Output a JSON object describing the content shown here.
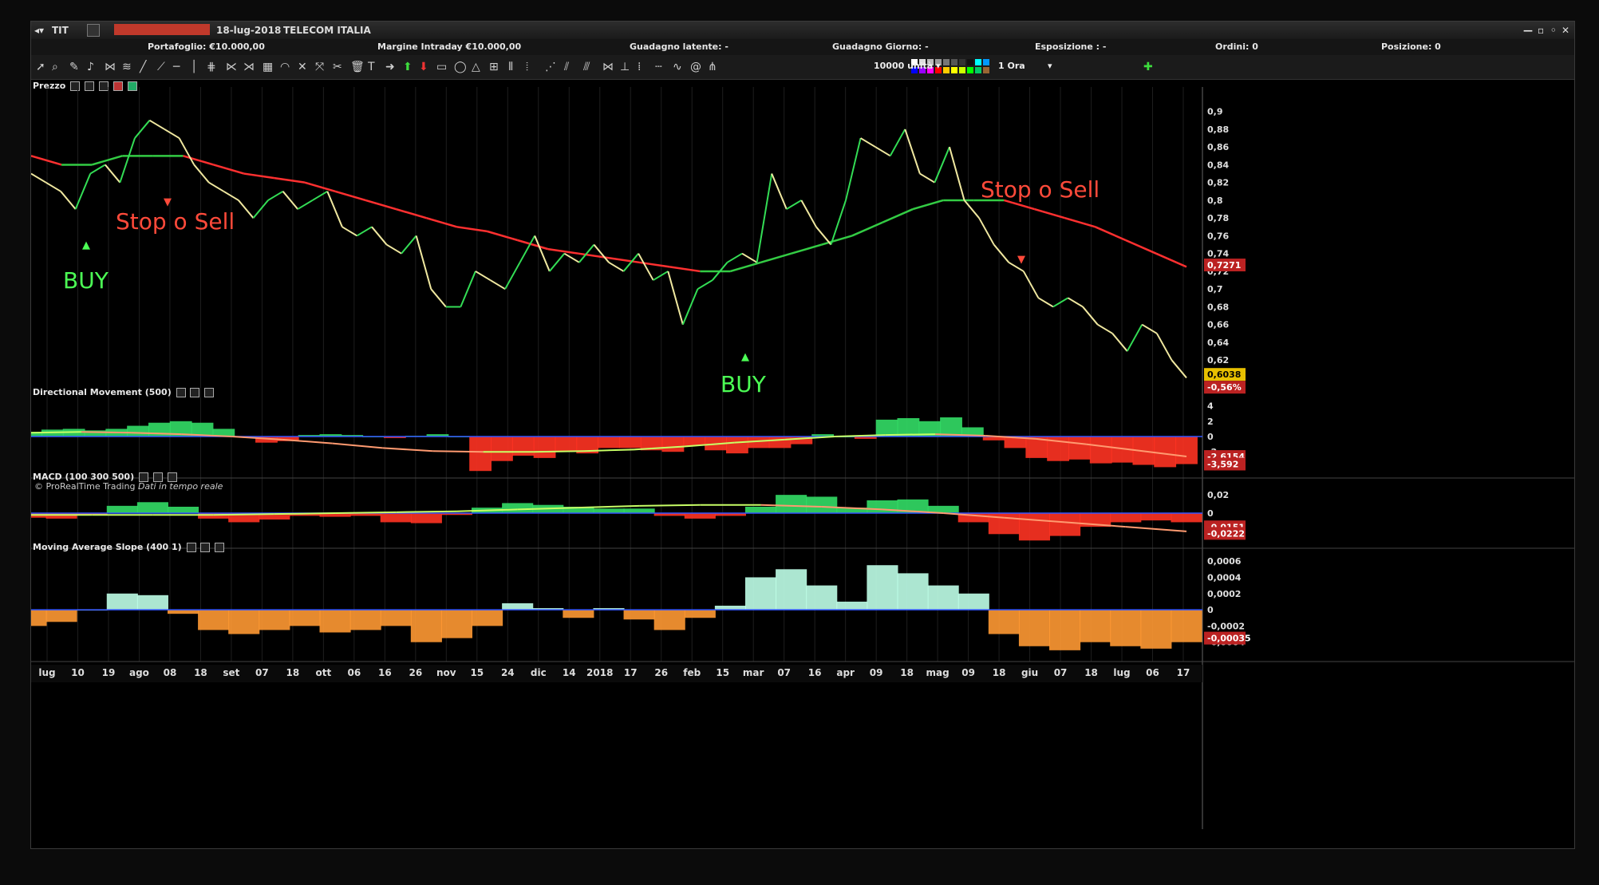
{
  "window": {
    "ticker_label": "TIT",
    "timestamp": "18-lug-2018",
    "instrument_name": "TELECOM ITALIA"
  },
  "info_bar": {
    "portafoglio": "Portafoglio: €10.000,00",
    "margine": "Margine Intraday €10.000,00",
    "guadagno_latente": "Guadagno latente: -",
    "guadagno_giorno": "Guadagno Giorno: -",
    "esposizione": "Esposizione : -",
    "ordini": "Ordini: 0",
    "posizione": "Posizione: 0"
  },
  "toolbar": {
    "units_select": "10000 unità",
    "timeframe_select": "1 Ora",
    "swatch_colors": [
      "#ffffff",
      "#dddddd",
      "#bbbbbb",
      "#999999",
      "#777777",
      "#555555",
      "#333333",
      "#111111",
      "#00ffff",
      "#0099ff",
      "#0000ff",
      "#9900ff",
      "#ff00ff",
      "#ff0000",
      "#ffcc00",
      "#ffff00",
      "#ccff00",
      "#00ff00",
      "#00cc66",
      "#996633"
    ]
  },
  "price_panel": {
    "title": "Prezzo",
    "copyright": "© ProRealTime Trading",
    "realtime": "Dati in tempo reale",
    "price_badge": "0,6038",
    "change_badge": "-0,56%",
    "ma_badge": "0,7271"
  },
  "indicators": {
    "dm": {
      "title": "Directional Movement (500)",
      "badge1": "-2,6154",
      "badge2": "-3,592"
    },
    "macd": {
      "title": "MACD (100 300 500)",
      "badge1": "-0,0151",
      "badge2": "-0,0222"
    },
    "mas": {
      "title": "Moving Average Slope (400 1)",
      "badge1": "-0,00035"
    }
  },
  "colors": {
    "price_up": "#33dd55",
    "price_down": "#f0e8a0",
    "ma_up": "#33cc44",
    "ma_down": "#ff3030",
    "hist_pos": "#33dd66",
    "hist_neg": "#ff3322",
    "slope_pos": "#bfffe8",
    "slope_neg": "#ff9933",
    "zero_line": "#3355ff",
    "buy": "#4cff55",
    "sell": "#ff4a3a"
  },
  "chart_data": [
    {
      "type": "line",
      "panel": "price",
      "x": [
        "lug",
        "10",
        "19",
        "ago",
        "08",
        "18",
        "set",
        "07",
        "18",
        "ott",
        "06",
        "16",
        "26",
        "nov",
        "15",
        "24",
        "dic",
        "14",
        "2018",
        "17",
        "26",
        "feb",
        "15",
        "mar",
        "07",
        "16",
        "apr",
        "09",
        "18",
        "mag",
        "09",
        "18",
        "giu",
        "07",
        "18",
        "lug",
        "06",
        "17"
      ],
      "yticks": [
        0.9,
        0.88,
        0.86,
        0.84,
        0.82,
        0.8,
        0.78,
        0.76,
        0.74,
        0.72,
        0.7,
        0.68,
        0.66,
        0.64,
        0.62
      ],
      "ytick_labels": [
        "0,9",
        "0,88",
        "0,86",
        "0,84",
        "0,82",
        "0,8",
        "0,78",
        "0,76",
        "0,74",
        "0,72",
        "0,7",
        "0,68",
        "0,66",
        "0,64",
        "0,62"
      ],
      "ylim": [
        0.595,
        0.915
      ],
      "series": [
        {
          "values": [
            0.83,
            0.82,
            0.81,
            0.79,
            0.83,
            0.84,
            0.82,
            0.87,
            0.89,
            0.88,
            0.87,
            0.84,
            0.82,
            0.81,
            0.8,
            0.78,
            0.8,
            0.81,
            0.79,
            0.8,
            0.81,
            0.77,
            0.76,
            0.77,
            0.75,
            0.74,
            0.76,
            0.7,
            0.68,
            0.68,
            0.72,
            0.71,
            0.7,
            0.73,
            0.76,
            0.72,
            0.74,
            0.73,
            0.75,
            0.73,
            0.72,
            0.74,
            0.71,
            0.72,
            0.66,
            0.7,
            0.71,
            0.73,
            0.74,
            0.73,
            0.83,
            0.79,
            0.8,
            0.77,
            0.75,
            0.8,
            0.87,
            0.86,
            0.85,
            0.88,
            0.83,
            0.82,
            0.86,
            0.8,
            0.78,
            0.75,
            0.73,
            0.72,
            0.69,
            0.68,
            0.69,
            0.68,
            0.66,
            0.65,
            0.63,
            0.66,
            0.65,
            0.62,
            0.6
          ]
        },
        {
          "values": [
            0.85,
            0.84,
            0.84,
            0.85,
            0.85,
            0.85,
            0.84,
            0.83,
            0.825,
            0.82,
            0.81,
            0.8,
            0.79,
            0.78,
            0.77,
            0.765,
            0.755,
            0.745,
            0.74,
            0.735,
            0.73,
            0.725,
            0.72,
            0.72,
            0.73,
            0.74,
            0.75,
            0.76,
            0.775,
            0.79,
            0.8,
            0.8,
            0.8,
            0.79,
            0.78,
            0.77,
            0.755,
            0.74,
            0.725
          ]
        }
      ],
      "annotations": [
        {
          "text": "BUY",
          "color": "buy"
        },
        {
          "text": "Stop o Sell",
          "color": "sell"
        },
        {
          "text": "BUY",
          "color": "buy"
        },
        {
          "text": "Stop o Sell",
          "color": "sell"
        }
      ]
    },
    {
      "type": "area",
      "panel": "dm",
      "yticks": [
        4,
        2,
        0,
        -2,
        -4
      ],
      "ylim": [
        -5,
        5
      ],
      "values": [
        0.6,
        0.9,
        1.0,
        0.8,
        1.0,
        1.4,
        1.8,
        2.0,
        1.8,
        1.0,
        0.0,
        -0.8,
        -0.6,
        0.2,
        0.3,
        0.2,
        0.0,
        -0.2,
        0.1,
        0.3,
        0.0,
        -4.5,
        -3.2,
        -2.5,
        -2.8,
        -2.0,
        -2.2,
        -1.5,
        -1.5,
        -1.8,
        -2.0,
        -1.2,
        -1.8,
        -2.2,
        -1.5,
        -1.5,
        -1.0,
        0.3,
        0.0,
        -0.3,
        2.2,
        2.4,
        2.0,
        2.5,
        1.2,
        -0.5,
        -1.5,
        -2.8,
        -3.2,
        -3.0,
        -3.5,
        -3.4,
        -3.7,
        -4.0,
        -3.6
      ],
      "signal": [
        0.5,
        0.6,
        0.5,
        0.3,
        0.0,
        -0.4,
        -0.9,
        -1.5,
        -1.9,
        -2.0,
        -2.0,
        -1.9,
        -1.7,
        -1.3,
        -0.8,
        -0.4,
        0.0,
        0.2,
        0.3,
        0.1,
        -0.3,
        -1.0,
        -1.8,
        -2.6
      ]
    },
    {
      "type": "area",
      "panel": "macd",
      "yticks": [
        0.02,
        0,
        -0.02
      ],
      "ytick_labels": [
        "0,02",
        "0",
        "-0,02"
      ],
      "ylim": [
        -0.035,
        0.035
      ],
      "values": [
        -0.005,
        -0.006,
        -0.002,
        0.008,
        0.012,
        0.007,
        -0.006,
        -0.01,
        -0.007,
        -0.003,
        -0.004,
        -0.003,
        -0.01,
        -0.011,
        -0.002,
        0.006,
        0.011,
        0.009,
        0.007,
        0.005,
        0.005,
        -0.003,
        -0.006,
        -0.003,
        0.007,
        0.02,
        0.018,
        0.006,
        0.014,
        0.015,
        0.008,
        -0.01,
        -0.023,
        -0.03,
        -0.025,
        -0.015,
        -0.01,
        -0.008,
        -0.01
      ],
      "signal": [
        -0.002,
        -0.002,
        -0.002,
        -0.002,
        -0.001,
        0.0,
        0.001,
        0.002,
        0.004,
        0.006,
        0.008,
        0.009,
        0.009,
        0.007,
        0.004,
        0.0,
        -0.005,
        -0.01,
        -0.015,
        -0.02
      ]
    },
    {
      "type": "area",
      "panel": "mas",
      "yticks": [
        0.0006,
        0.0004,
        0.0002,
        0,
        -0.0002,
        -0.0004
      ],
      "ytick_labels": [
        "0,0006",
        "0,0004",
        "0,0002",
        "0",
        "-0,0002",
        "-0,0004"
      ],
      "ylim": [
        -0.0006,
        0.0007
      ],
      "values": [
        -0.0002,
        -0.00015,
        0.0,
        0.0002,
        0.00018,
        -5e-05,
        -0.00025,
        -0.0003,
        -0.00025,
        -0.0002,
        -0.00028,
        -0.00025,
        -0.0002,
        -0.0004,
        -0.00035,
        -0.0002,
        8e-05,
        2e-05,
        -0.0001,
        2e-05,
        -0.00012,
        -0.00025,
        -0.0001,
        5e-05,
        0.0004,
        0.0005,
        0.0003,
        0.0001,
        0.00055,
        0.00045,
        0.0003,
        0.0002,
        -0.0003,
        -0.00045,
        -0.0005,
        -0.0004,
        -0.00045,
        -0.00048,
        -0.0004
      ]
    }
  ]
}
